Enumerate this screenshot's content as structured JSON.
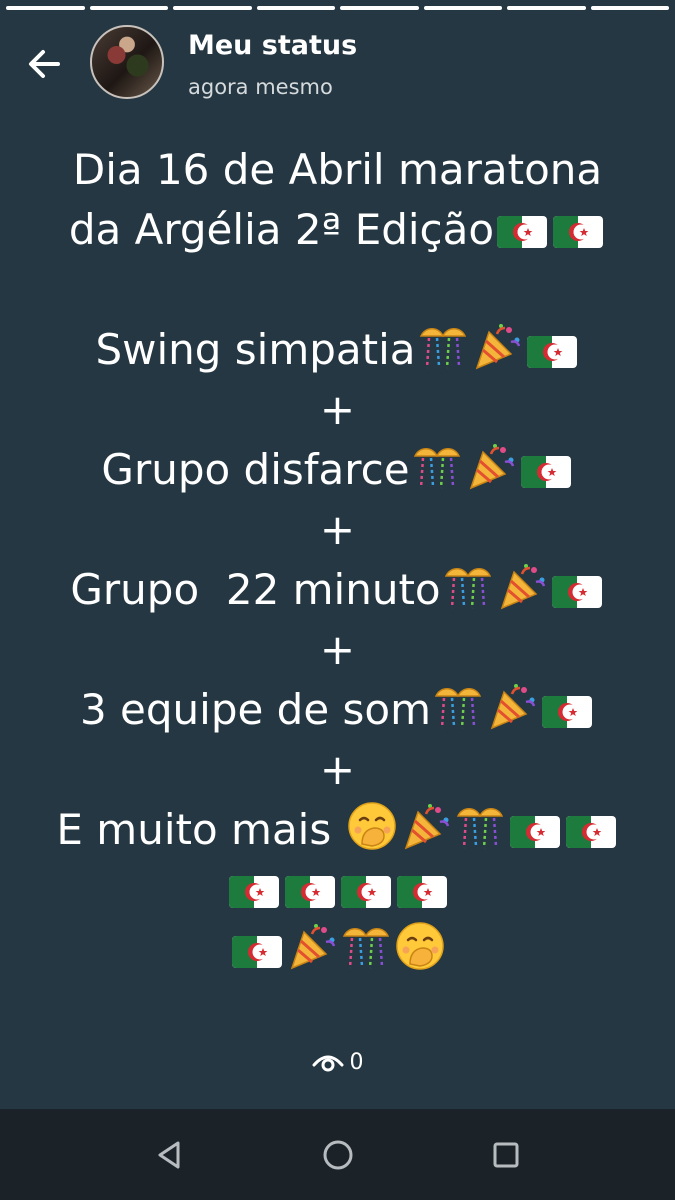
{
  "header": {
    "title": "Meu status",
    "time": "agora mesmo"
  },
  "progress_segments": 8,
  "status": {
    "lines": [
      {
        "text": "Dia 16 de Abril maratona",
        "emoji": []
      },
      {
        "text": "da Argélia 2ª Edição",
        "emoji": [
          "flag-algeria",
          "flag-algeria"
        ]
      },
      {
        "text": "",
        "emoji": []
      },
      {
        "text": "Swing simpatia",
        "emoji": [
          "confetti-ball",
          "party-popper",
          "flag-algeria"
        ]
      },
      {
        "text": "+",
        "emoji": []
      },
      {
        "text": "Grupo disfarce",
        "emoji": [
          "confetti-ball",
          "party-popper",
          "flag-algeria"
        ]
      },
      {
        "text": "+",
        "emoji": []
      },
      {
        "text": "Grupo  22 minuto",
        "emoji": [
          "confetti-ball",
          "party-popper",
          "flag-algeria"
        ]
      },
      {
        "text": "+",
        "emoji": []
      },
      {
        "text": "3 equipe de som",
        "emoji": [
          "confetti-ball",
          "party-popper",
          "flag-algeria"
        ]
      },
      {
        "text": "+",
        "emoji": []
      },
      {
        "text": "E muito mais ",
        "emoji": [
          "hand-over-mouth",
          "party-popper",
          "confetti-ball",
          "flag-algeria",
          "flag-algeria"
        ]
      },
      {
        "text": "",
        "emoji": [
          "flag-algeria",
          "flag-algeria",
          "flag-algeria",
          "flag-algeria"
        ]
      },
      {
        "text": "",
        "emoji": [
          "flag-algeria",
          "party-popper",
          "confetti-ball",
          "hand-over-mouth"
        ]
      }
    ]
  },
  "views": {
    "count": "0",
    "icon": "eye-icon"
  },
  "navbar": {
    "icons": [
      "back-triangle-icon",
      "home-circle-icon",
      "recents-square-icon"
    ]
  },
  "colors": {
    "background": "#253742",
    "navbar": "#1c2328"
  }
}
